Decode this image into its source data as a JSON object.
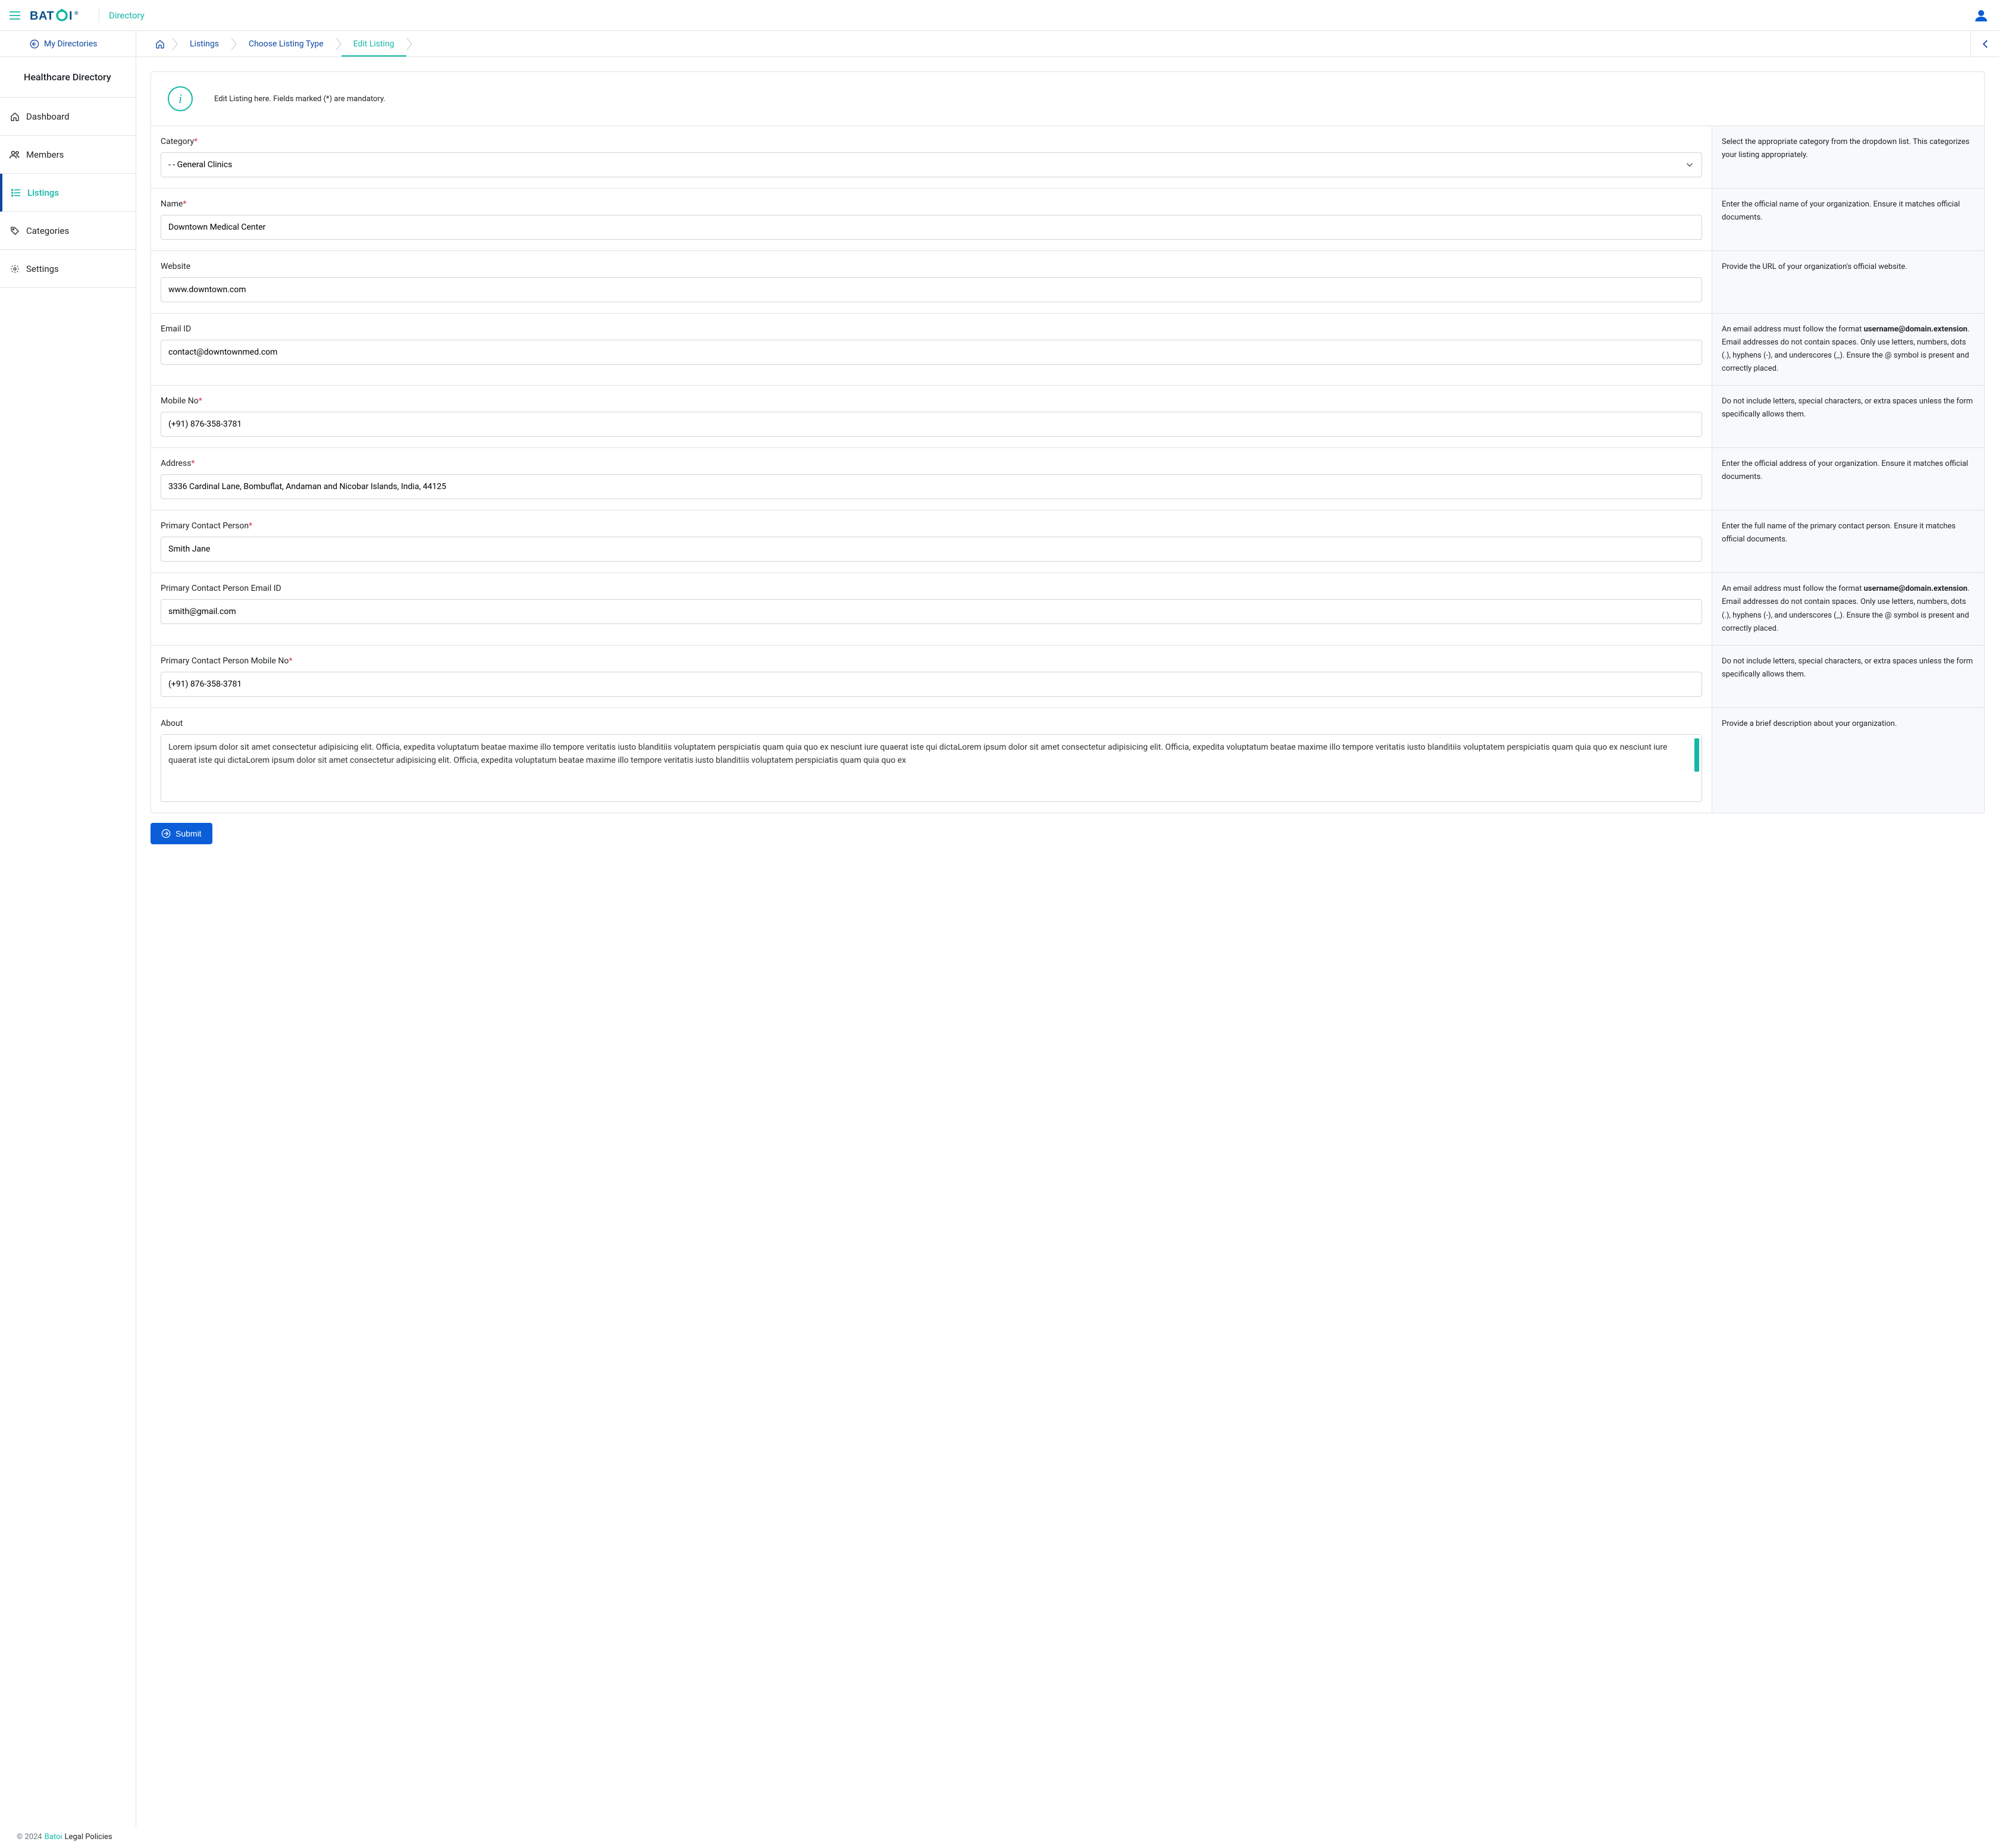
{
  "header": {
    "logo_text": "BATOI",
    "logo_reg": "®",
    "title": "Directory"
  },
  "breadcrumb": {
    "back_label": "My Directories",
    "items": [
      {
        "label": "Listings",
        "active": false
      },
      {
        "label": "Choose Listing Type",
        "active": false
      },
      {
        "label": "Edit Listing",
        "active": true
      }
    ]
  },
  "sidebar": {
    "title": "Healthcare Directory",
    "items": [
      {
        "label": "Dashboard",
        "icon": "home"
      },
      {
        "label": "Members",
        "icon": "users"
      },
      {
        "label": "Listings",
        "icon": "list",
        "active": true
      },
      {
        "label": "Categories",
        "icon": "tag"
      },
      {
        "label": "Settings",
        "icon": "gear"
      }
    ]
  },
  "info_banner": "Edit Listing here. Fields marked (*) are mandatory.",
  "fields": {
    "category": {
      "label": "Category",
      "required": true,
      "selected": "- - General Clinics",
      "help": "Select the appropriate category from the dropdown list. This categorizes your listing appropriately."
    },
    "name": {
      "label": "Name",
      "required": true,
      "value": "Downtown Medical Center",
      "help": "Enter the official name of your organization. Ensure it matches official documents."
    },
    "website": {
      "label": "Website",
      "required": false,
      "value": "www.downtown.com",
      "help": "Provide the URL of your organization's official website."
    },
    "email": {
      "label": "Email ID",
      "required": false,
      "value": "contact@downtownmed.com",
      "help_prefix": "An email address must follow the format ",
      "help_bold": "username@domain.extension",
      "help_suffix": ". Email addresses do not contain spaces. Only use letters, numbers, dots (.), hyphens (-), and underscores (_). Ensure the @ symbol is present and correctly placed."
    },
    "mobile": {
      "label": "Mobile No",
      "required": true,
      "value": "(+91) 876-358-3781",
      "help": "Do not include letters, special characters, or extra spaces unless the form specifically allows them."
    },
    "address": {
      "label": "Address",
      "required": true,
      "value": "3336 Cardinal Lane, Bombuflat, Andaman and Nicobar Islands, India, 44125",
      "help": "Enter the official address of your organization. Ensure it matches official documents."
    },
    "primary_contact": {
      "label": "Primary Contact Person",
      "required": true,
      "value": "Smith Jane",
      "help": "Enter the full name of the primary contact person. Ensure it matches official documents."
    },
    "primary_email": {
      "label": "Primary Contact Person Email ID",
      "required": false,
      "value": "smith@gmail.com",
      "help_prefix": "An email address must follow the format ",
      "help_bold": "username@domain.extension",
      "help_suffix": ". Email addresses do not contain spaces. Only use letters, numbers, dots (.), hyphens (-), and underscores (_). Ensure the @ symbol is present and correctly placed."
    },
    "primary_mobile": {
      "label": "Primary Contact Person Mobile No",
      "required": true,
      "value": "(+91) 876-358-3781",
      "help": "Do not include letters, special characters, or extra spaces unless the form specifically allows them."
    },
    "about": {
      "label": "About",
      "required": false,
      "value": "Lorem ipsum dolor sit amet consectetur adipisicing elit. Officia, expedita voluptatum beatae maxime illo tempore veritatis iusto blanditiis voluptatem perspiciatis quam quia quo ex nesciunt iure quaerat iste qui dictaLorem ipsum dolor sit amet consectetur adipisicing elit. Officia, expedita voluptatum beatae maxime illo tempore veritatis iusto blanditiis voluptatem perspiciatis quam quia quo ex nesciunt iure quaerat iste qui dictaLorem ipsum dolor sit amet consectetur adipisicing elit. Officia, expedita voluptatum beatae maxime illo tempore veritatis iusto blanditiis voluptatem perspiciatis quam quia quo ex",
      "help": "Provide a brief description about your organization."
    }
  },
  "submit_label": "Submit",
  "footer": {
    "copyright": "© 2024",
    "brand": "Batoi",
    "policies": "Legal Policies"
  }
}
